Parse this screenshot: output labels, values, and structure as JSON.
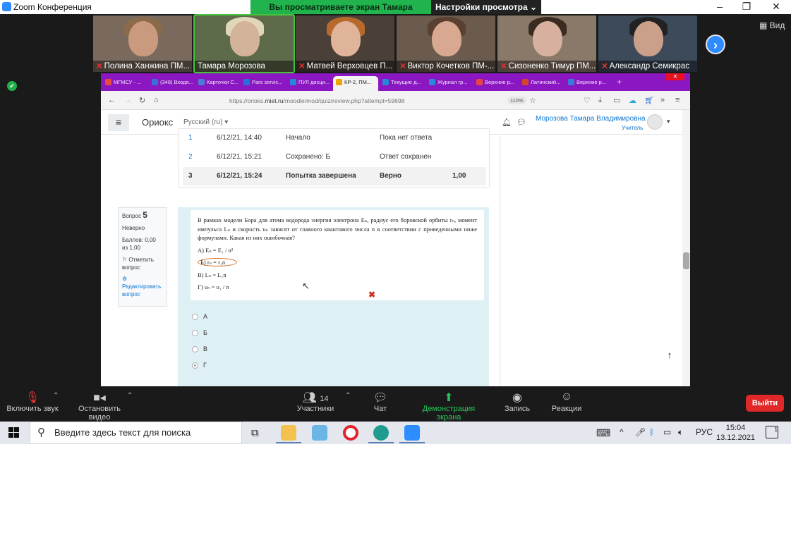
{
  "zoom": {
    "window_title": "Zoom Конференция",
    "share_banner": "Вы просматриваете экран Тамара Морозова",
    "view_settings": "Настройки просмотра ⌄",
    "view_label": "Вид",
    "participants_tiles": [
      {
        "name": "Полина Ханжина ПМ...",
        "muted": true
      },
      {
        "name": "Тамара Морозова",
        "muted": false
      },
      {
        "name": "Матвей Верховцев П...",
        "muted": true
      },
      {
        "name": "Виктор Кочетков ПМ-...",
        "muted": true
      },
      {
        "name": "Сизоненко Тимур ПМ...",
        "muted": true
      },
      {
        "name": "Александр Семикрас",
        "muted": true
      }
    ],
    "toolbar": {
      "mute_label": "Включить звук",
      "video_label": "Остановить видео",
      "participants_count": "14",
      "participants_label": "Участники",
      "chat_label": "Чат",
      "share_label": "Демонстрация экрана",
      "record_label": "Запись",
      "reactions_label": "Реакции",
      "leave_label": "Выйти"
    }
  },
  "browser": {
    "tabs": [
      {
        "label": "МГМСУ - ...",
        "color": "#e84b3c"
      },
      {
        "label": "(348) Входя...",
        "color": "#3b6fd8"
      },
      {
        "label": "Карточки С...",
        "color": "#4a7bd6"
      },
      {
        "label": "Pars servic...",
        "color": "#2a6fd6"
      },
      {
        "label": "ПУЛ дисци...",
        "color": "#2a86d6"
      },
      {
        "label": "КР-2, ПМ...",
        "color": "#f0a400"
      },
      {
        "label": "Текущие д...",
        "color": "#2a86d6"
      },
      {
        "label": "Журнал гр...",
        "color": "#2a86d6"
      },
      {
        "label": "Верхние р...",
        "color": "#e8453c"
      },
      {
        "label": "Латинский...",
        "color": "#d6452a"
      },
      {
        "label": "Верхние р...",
        "color": "#3a7bd6"
      }
    ],
    "url_prefix": "https://orioks.",
    "url_domain": "miet.ru",
    "url_suffix": "/moodle/mod/quiz/review.php?attempt=59698",
    "zoom_level": "110%"
  },
  "moodle": {
    "brand": "Ориокс",
    "language": "Русский (ru) ▾",
    "user_name": "Морозова Тамара Владимировна",
    "user_role": "Учитель",
    "history_rows": [
      {
        "step": "1",
        "time": "6/12/21, 14:40",
        "action": "Начало",
        "state": "Пока нет ответа",
        "marks": ""
      },
      {
        "step": "2",
        "time": "6/12/21, 15:21",
        "action": "Сохранено: Б",
        "state": "Ответ сохранен",
        "marks": ""
      },
      {
        "step": "3",
        "time": "6/12/21, 15:24",
        "action": "Попытка завершена",
        "state": "Верно",
        "marks": "1,00"
      }
    ],
    "question": {
      "label": "Вопрос",
      "number": "5",
      "status": "Неверно",
      "score": "Баллов: 0,00 из 1,00",
      "flag": "Отметить вопрос",
      "edit": "Редактировать вопрос",
      "text": "В рамках модели Бора для атома водорода энергия электрона Eₙ, радиус его боровской орбиты rₙ, момент импульса Lₙ и скорость υₙ зависят от главного квантового числа n в соответствии с приведенными ниже формулами. Какая из них ошибочная?",
      "formula_a": "А) Eₙ = E₁ / n²",
      "formula_b": "Б) rₙ = r₁n",
      "formula_c": "В) Lₙ = L₁n",
      "formula_d": "Г) υₙ = υ₁ / n",
      "answers": [
        {
          "label": "А",
          "checked": false
        },
        {
          "label": "Б",
          "checked": false
        },
        {
          "label": "В",
          "checked": false
        },
        {
          "label": "Г",
          "checked": true
        }
      ],
      "wrong_mark": "✖"
    }
  },
  "taskbar": {
    "search_placeholder": "Введите здесь текст для поиска",
    "lang": "РУС",
    "time": "15:04",
    "date": "13.12.2021",
    "notifications": "1"
  }
}
